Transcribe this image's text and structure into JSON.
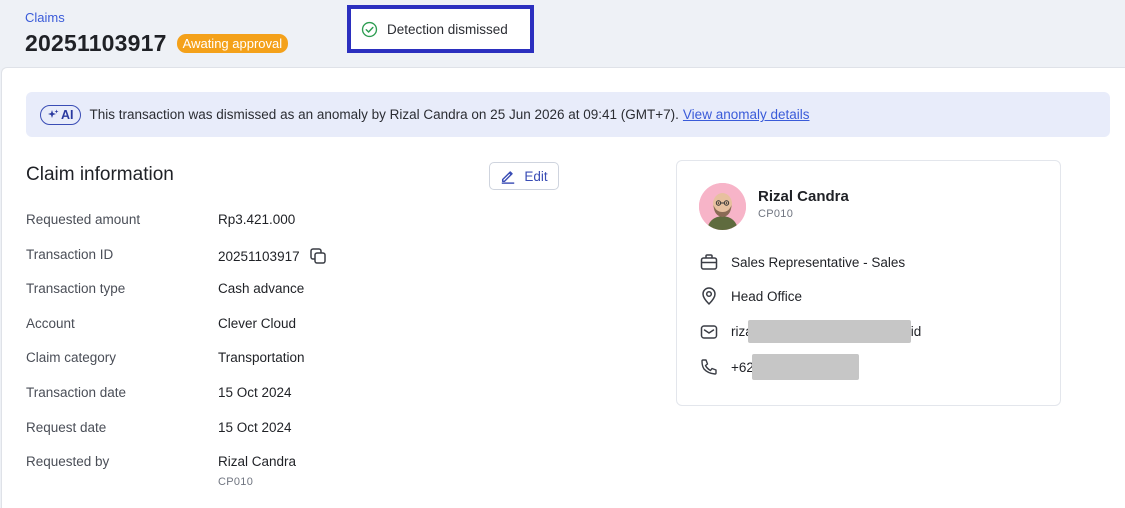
{
  "header": {
    "breadcrumb": "Claims",
    "title": "20251103917",
    "status_badge": "Awating approval"
  },
  "toast": {
    "message": "Detection dismissed"
  },
  "banner": {
    "ai_label": "AI",
    "message": "This transaction was dismissed as an anomaly by Rizal Candra on 25 Jun 2026 at 09:41 (GMT+7).",
    "link_label": "View anomaly details"
  },
  "claim_info": {
    "title": "Claim information",
    "edit_label": "Edit",
    "rows": [
      {
        "label": "Requested amount",
        "value": "Rp3.421.000"
      },
      {
        "label": "Transaction ID",
        "value": "20251103917"
      },
      {
        "label": "Transaction type",
        "value": "Cash advance"
      },
      {
        "label": "Account",
        "value": "Clever Cloud"
      },
      {
        "label": "Claim category",
        "value": "Transportation"
      },
      {
        "label": "Transaction date",
        "value": "15 Oct 2024"
      },
      {
        "label": "Request date",
        "value": "15 Oct 2024"
      },
      {
        "label": "Requested by",
        "value": "Rizal Candra",
        "sub_value": "CP010"
      }
    ]
  },
  "profile": {
    "name": "Rizal Candra",
    "code": "CP010",
    "position": "Sales Representative - Sales",
    "location": "Head Office",
    "email_prefix": "riza",
    "email_suffix": "id",
    "phone_prefix": "+62"
  },
  "colors": {
    "accent": "#3a5bd9",
    "badge": "#f4a11a",
    "toast_border": "#2b2fbf",
    "banner_bg": "#e8ecfa"
  }
}
